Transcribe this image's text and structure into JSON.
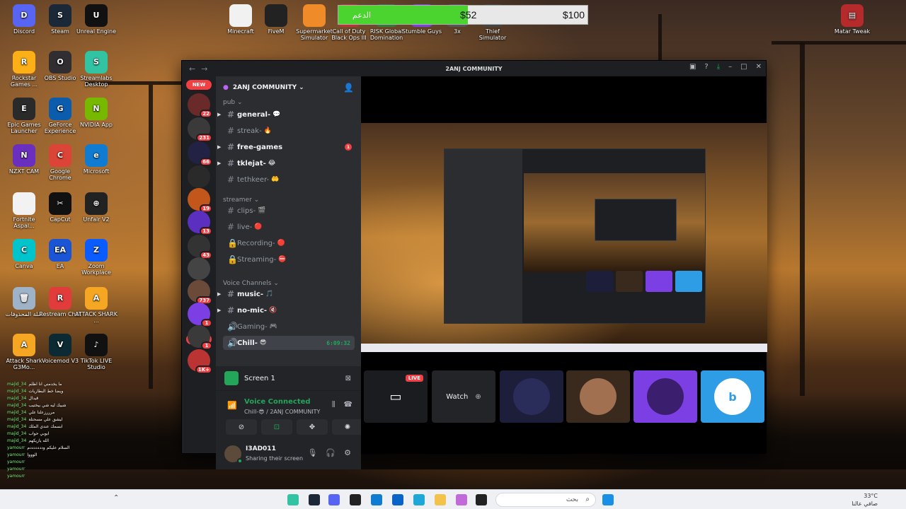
{
  "desktop": {
    "icons": [
      {
        "label": "Discord",
        "color": "#5865f2",
        "glyph": "D"
      },
      {
        "label": "Steam",
        "color": "#1b2838",
        "glyph": "S"
      },
      {
        "label": "Unreal Engine",
        "color": "#111111",
        "glyph": "U"
      },
      {
        "label": "Rockstar Games ...",
        "color": "#fcaf17",
        "glyph": "R"
      },
      {
        "label": "OBS Studio",
        "color": "#302e31",
        "glyph": "O"
      },
      {
        "label": "Streamlabs Desktop",
        "color": "#31c3a2",
        "glyph": "S"
      },
      {
        "label": "Epic Games Launcher",
        "color": "#2a2a2a",
        "glyph": "E"
      },
      {
        "label": "GeForce Experience",
        "color": "#0b5cad",
        "glyph": "G"
      },
      {
        "label": "NVIDIA App",
        "color": "#76b900",
        "glyph": "N"
      },
      {
        "label": "NZXT CAM",
        "color": "#6b2fbf",
        "glyph": "N"
      },
      {
        "label": "Google Chrome",
        "color": "#db4437",
        "glyph": "C"
      },
      {
        "label": "Microsoft",
        "color": "#0f7bd1",
        "glyph": "e"
      },
      {
        "label": "Fortnite Aspal...",
        "color": "#f2f2f2",
        "glyph": ""
      },
      {
        "label": "CapCut",
        "color": "#111111",
        "glyph": "✂"
      },
      {
        "label": "Unfair V2",
        "color": "#222222",
        "glyph": "⊕"
      },
      {
        "label": "Canva",
        "color": "#00c4cc",
        "glyph": "C"
      },
      {
        "label": "EA",
        "color": "#1a55d6",
        "glyph": "EA"
      },
      {
        "label": "Zoom Workplace",
        "color": "#0b5cff",
        "glyph": "Z"
      },
      {
        "label": "سلة المحذوفات",
        "color": "#9fb3c8",
        "glyph": "🗑"
      },
      {
        "label": "Restream Chat",
        "color": "#e23b3b",
        "glyph": "R"
      },
      {
        "label": "ATTACK SHARK ...",
        "color": "#f5a623",
        "glyph": "A"
      },
      {
        "label": "Attack Shark G3Mo...",
        "color": "#f5a623",
        "glyph": "A"
      },
      {
        "label": "Voicemod V3",
        "color": "#0c2a33",
        "glyph": "V"
      },
      {
        "label": "TikTok LIVE Studio",
        "color": "#111111",
        "glyph": "♪"
      }
    ],
    "top_icons": [
      {
        "label": "Minecraft",
        "color": "#f1f1f1"
      },
      {
        "label": "FiveM",
        "color": "#222222"
      },
      {
        "label": "Supermarket Simulator",
        "color": "#f08b2a"
      },
      {
        "label": "Call of Duty Black Ops III",
        "color": "#b33"
      },
      {
        "label": "RISK Global Domination",
        "color": "#2e7d32"
      },
      {
        "label": "Stumble Guys",
        "color": "#7b3fe4"
      },
      {
        "label": "3x",
        "color": "#555"
      },
      {
        "label": "Thief Simulator",
        "color": "#444"
      }
    ],
    "right_icon": {
      "label": "Matar Tweak",
      "color": "#b52a2a"
    }
  },
  "donation_bar": {
    "label": "الدعم",
    "current": "$52",
    "goal": "$100",
    "progress": 0.52,
    "fill_color": "#4bd32f"
  },
  "discord": {
    "window_title": "2ANJ COMMUNITY",
    "servers": [
      {
        "badge": "22",
        "color": "#6b2a2a"
      },
      {
        "badge": "231",
        "color": "#3a3a3a"
      },
      {
        "badge": "66",
        "color": "#222244"
      },
      {
        "badge": "",
        "color": "#2a2a2a"
      },
      {
        "badge": "19",
        "color": "#c2561b"
      },
      {
        "badge": "13",
        "color": "#5b2fbf"
      },
      {
        "badge": "43",
        "color": "#333333"
      },
      {
        "badge": "",
        "color": "#444444"
      },
      {
        "badge": "737",
        "color": "#6b4a3a"
      },
      {
        "badge": "1",
        "color": "#7b3fe4"
      },
      {
        "badge": "1",
        "color": "#3a3a3a"
      },
      {
        "badge": "1K+",
        "color": "#b33"
      }
    ],
    "new_label": "NEW",
    "guild_name": "2ANJ COMMUNITY",
    "categories": [
      {
        "name": "pub"
      },
      {
        "name": "streamer"
      },
      {
        "name": "Voice Channels"
      }
    ],
    "channels": [
      {
        "name": "general-",
        "emoji": "💬",
        "unread": true
      },
      {
        "name": "streak-",
        "emoji": "🔥",
        "unread": false
      },
      {
        "name": "free-games",
        "emoji": "",
        "unread": true,
        "mentions": "1"
      },
      {
        "name": "tklejat-",
        "emoji": "😂",
        "unread": true
      },
      {
        "name": "tethkeer-",
        "emoji": "🤲",
        "unread": false
      },
      {
        "name": "clips-",
        "emoji": "🎬",
        "unread": false
      },
      {
        "name": "live-",
        "emoji": "🔴",
        "unread": false
      },
      {
        "name": "Recording-",
        "emoji": "🔴",
        "unread": false
      },
      {
        "name": "Streaming-",
        "emoji": "⛔",
        "unread": false
      },
      {
        "name": "music-",
        "emoji": "🎵",
        "unread": true
      },
      {
        "name": "no-mic-",
        "emoji": "🔇",
        "unread": true
      },
      {
        "name": "Gaming-",
        "emoji": "🎮",
        "unread": false
      },
      {
        "name": "Chill-",
        "emoji": "😎",
        "unread": true,
        "timer": "6:09:32"
      }
    ],
    "screen_share": {
      "label": "Screen 1"
    },
    "voice": {
      "status": "Voice Connected",
      "location": "Chill-😎 / 2ANJ COMMUNITY"
    },
    "user": {
      "name": "I3AD011",
      "status": "Sharing their screen"
    },
    "stage": {
      "live_label": "LIVE",
      "watch_label": "Watch",
      "tile_colors": [
        "#1d1f3a",
        "#3a2a1e",
        "#7b3fe4",
        "#2e9de6"
      ]
    }
  },
  "chat_overlay": {
    "lines": [
      {
        "user": "majid_34",
        "text": "ما يخدمني انا اظلم"
      },
      {
        "user": "majid_34",
        "text": "ويضا خط البطاريات"
      },
      {
        "user": "majid_34",
        "text": "قيدال"
      },
      {
        "user": "majid_34",
        "text": "شبيك ليه شي بيختيب"
      },
      {
        "user": "majid_34",
        "text": "مرررزعلنا علي"
      },
      {
        "user": "majid_34",
        "text": "ليشق علي مسحتلة"
      },
      {
        "user": "majid_34",
        "text": "ابسمك عندي الملك"
      },
      {
        "user": "majid_34",
        "text": "ابوبي حواب"
      },
      {
        "user": "majid_34",
        "text": "الله يازيكهم"
      },
      {
        "user": "yamourr",
        "text": "السلام عليكم ودددددددم"
      },
      {
        "user": "yamourr",
        "text": "الوووا"
      },
      {
        "user": "yamourr",
        "text": ""
      },
      {
        "user": "yamourr",
        "text": ""
      },
      {
        "user": "yamourr",
        "text": ""
      }
    ]
  },
  "taskbar": {
    "search_placeholder": "بحث",
    "weather_temp": "33°C",
    "weather_desc": "صافي عالنا"
  }
}
